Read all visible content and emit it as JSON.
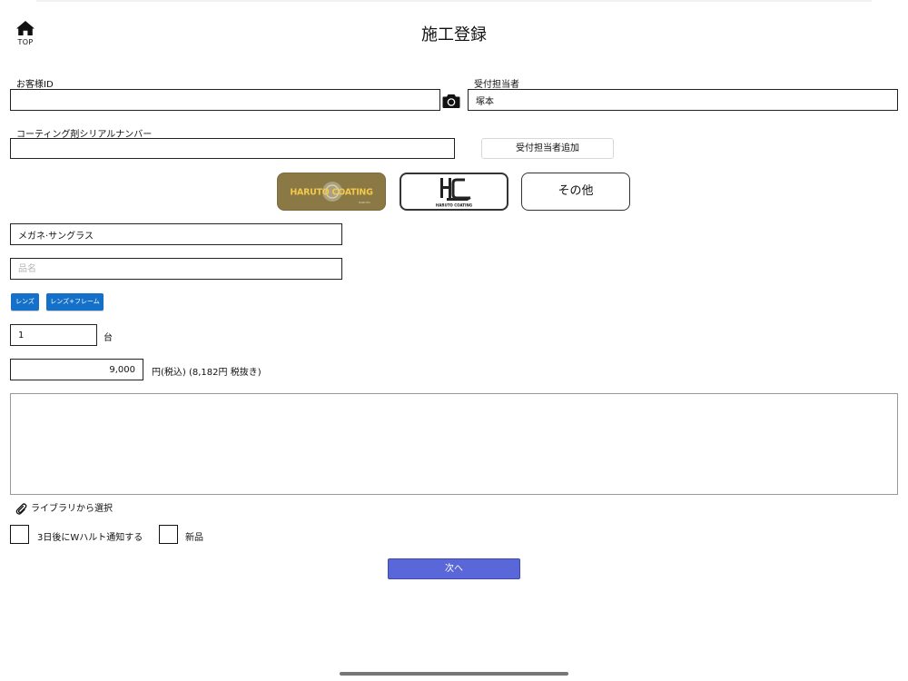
{
  "header": {
    "home_label": "TOP",
    "title": "施工登録"
  },
  "customer": {
    "id_label": "お客様ID",
    "id_value": "",
    "camera_icon": "camera-icon"
  },
  "staff": {
    "label": "受付担当者",
    "value": "塚本",
    "add_button": "受付担当者追加"
  },
  "serial": {
    "label": "コーティング剤シリアルナンバー",
    "value": ""
  },
  "brands": {
    "options": [
      {
        "logo_text": "HARUTO COATING",
        "selected": false
      },
      {
        "logo_text": "HARUTO COATING",
        "selected": true
      },
      {
        "label": "その他",
        "selected": false
      }
    ]
  },
  "category": {
    "value": "メガネ·サングラス"
  },
  "product_name": {
    "placeholder": "品名",
    "value": ""
  },
  "chips": [
    "レンズ",
    "レンズ+フレーム"
  ],
  "quantity": {
    "value": "1",
    "unit": "台"
  },
  "price": {
    "value": "9,000",
    "note": "円(税込) (8,182円 税抜き)"
  },
  "attachment": {
    "library_label": "ライブラリから選択",
    "icon": "paperclip-icon"
  },
  "options": {
    "notify_label": "3日後にWハルト通知する",
    "notify_checked": false,
    "new_label": "新品",
    "new_checked": false
  },
  "footer": {
    "next_label": "次へ"
  },
  "colors": {
    "accent": "#5a67d8",
    "chip": "#1470c8",
    "brand_gold": "#8a7845"
  }
}
